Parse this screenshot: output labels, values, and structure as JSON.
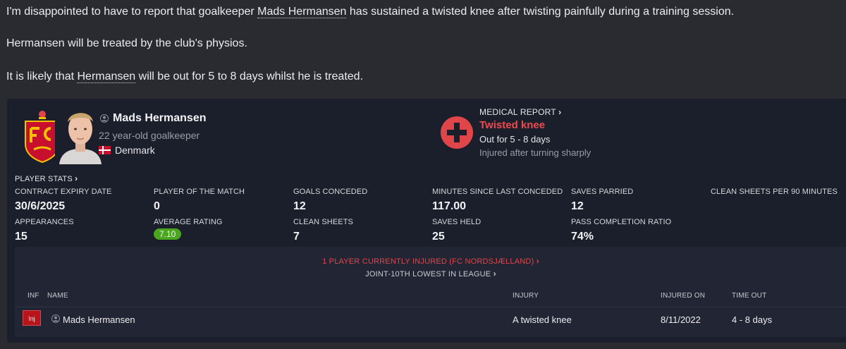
{
  "message": {
    "p1_before": "I'm disappointed to have to report that goalkeeper ",
    "p1_link": "Mads Hermansen",
    "p1_after": " has sustained a twisted knee after twisting painfully during a training session.",
    "p2_link": "Hermansen",
    "p2_after": " will be treated by the club's physios.",
    "p3_before": "It is likely that ",
    "p3_link": "Hermansen",
    "p3_after": " will be out for 5 to 8 days whilst he is treated."
  },
  "player": {
    "name": "Mads Hermansen",
    "description": "22 year-old goalkeeper",
    "nationality": "Denmark"
  },
  "medical": {
    "label": "MEDICAL REPORT",
    "injury": "Twisted knee",
    "out_for": "Out for 5 - 8 days",
    "detail": "Injured after turning sharply"
  },
  "stats": {
    "header": "PLAYER STATS",
    "items": [
      {
        "label": "CONTRACT EXPIRY DATE",
        "value": "30/6/2025"
      },
      {
        "label": "PLAYER OF THE MATCH",
        "value": "0"
      },
      {
        "label": "GOALS CONCEDED",
        "value": "12"
      },
      {
        "label": "MINUTES SINCE LAST CONCEDED",
        "value": "117.00"
      },
      {
        "label": "SAVES PARRIED",
        "value": "12"
      },
      {
        "label": "CLEAN SHEETS PER 90 MINUTES",
        "value": ""
      },
      {
        "label": "APPEARANCES",
        "value": "15"
      },
      {
        "label": "AVERAGE RATING",
        "value": "7.10"
      },
      {
        "label": "CLEAN SHEETS",
        "value": "7"
      },
      {
        "label": "SAVES HELD",
        "value": "25"
      },
      {
        "label": "PASS COMPLETION RATIO",
        "value": "74%"
      }
    ]
  },
  "injuries": {
    "summary": "1 PLAYER CURRENTLY INJURED (FC NORDSJÆLLAND)",
    "league_rank": "JOINT-10TH LOWEST IN LEAGUE",
    "columns": [
      "INF",
      "NAME",
      "INJURY",
      "INJURED ON",
      "TIME OUT"
    ],
    "rows": [
      {
        "inf": "Inj",
        "name": "Mads Hermansen",
        "injury": "A twisted knee",
        "injured_on": "8/11/2022",
        "time_out": "4 - 8 days"
      }
    ]
  },
  "colors": {
    "accent_red": "#e0454a",
    "rating_green": "#49a61e",
    "card_bg": "#1b1e2b"
  }
}
